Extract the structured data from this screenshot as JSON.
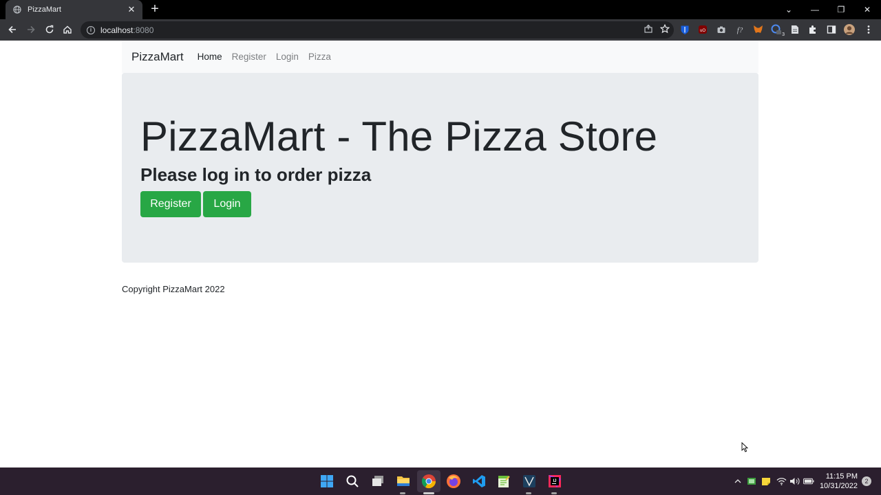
{
  "browser": {
    "tab_title": "PizzaMart",
    "tab_close": "✕",
    "new_tab": "+",
    "url_host": "localhost",
    "url_port": ":8080",
    "window_controls": {
      "minimize": "—",
      "maximize": "❐",
      "close": "✕",
      "tab_search": "⌄"
    },
    "extension_badge": "3"
  },
  "navbar": {
    "brand": "PizzaMart",
    "links": [
      {
        "label": "Home",
        "active": true
      },
      {
        "label": "Register",
        "active": false
      },
      {
        "label": "Login",
        "active": false
      },
      {
        "label": "Pizza",
        "active": false
      }
    ]
  },
  "hero": {
    "title": "PizzaMart - The Pizza Store",
    "subtitle": "Please log in to order pizza",
    "register_button": "Register",
    "login_button": "Login"
  },
  "footer": {
    "copyright": "Copyright PizzaMart 2022"
  },
  "colors": {
    "accent_green": "#28a745",
    "jumbotron_bg": "#e9ecef",
    "navbar_bg": "#f8f9fa",
    "chrome_dark": "#35363a",
    "taskbar_bg": "#2b1f2e"
  },
  "taskbar": {
    "apps": [
      "windows-start-icon",
      "search-icon",
      "task-view-icon",
      "file-explorer-icon",
      "chrome-icon",
      "firefox-icon",
      "vscode-icon",
      "notepad-icon",
      "sql-developer-icon",
      "intellij-icon"
    ],
    "time": "11:15 PM",
    "date": "10/31/2022",
    "notifications": "2"
  }
}
